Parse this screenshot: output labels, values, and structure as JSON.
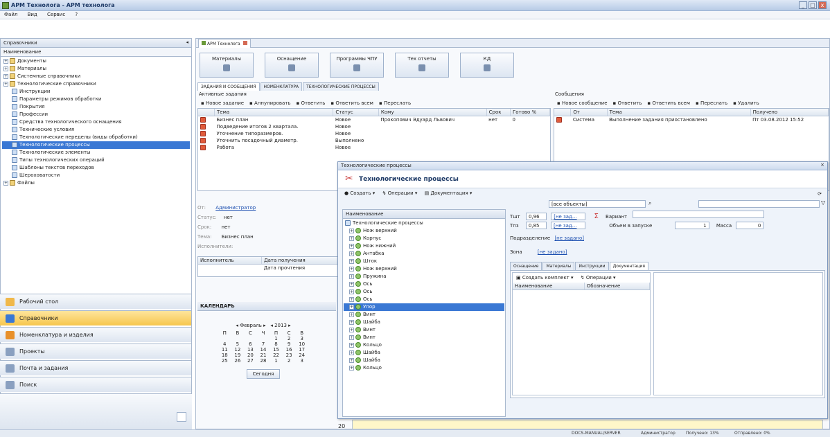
{
  "window": {
    "title": "АРМ Технолога - АРМ технолога",
    "min": "_",
    "max": "□",
    "close": "x"
  },
  "menu": [
    "Файл",
    "Вид",
    "Сервис",
    "?"
  ],
  "left_panel": {
    "title": "Справочники",
    "column_header": "Наименование",
    "tree": [
      {
        "label": "Документы",
        "level": 0,
        "icon": "folder-icon"
      },
      {
        "label": "Материалы",
        "level": 0,
        "icon": "folder-icon"
      },
      {
        "label": "Системные справочники",
        "level": 0,
        "icon": "folder-icon"
      },
      {
        "label": "Технологические справочники",
        "level": 0,
        "icon": "folder-icon"
      },
      {
        "label": "Инструкции",
        "level": 1,
        "icon": "doc-icon"
      },
      {
        "label": "Параметры режимов обработки",
        "level": 1,
        "icon": "doc-icon"
      },
      {
        "label": "Покрытия",
        "level": 1,
        "icon": "doc-icon"
      },
      {
        "label": "Профессии",
        "level": 1,
        "icon": "doc-icon"
      },
      {
        "label": "Средства технологического оснащения",
        "level": 1,
        "icon": "doc-icon"
      },
      {
        "label": "Технические условия",
        "level": 1,
        "icon": "doc-icon"
      },
      {
        "label": "Технологические переделы (виды обработки)",
        "level": 1,
        "icon": "doc-icon"
      },
      {
        "label": "Технологические процессы",
        "level": 1,
        "icon": "doc-icon",
        "selected": true
      },
      {
        "label": "Технологические элементы",
        "level": 1,
        "icon": "doc-icon"
      },
      {
        "label": "Типы технологических операций",
        "level": 1,
        "icon": "doc-icon"
      },
      {
        "label": "Шаблоны текстов переходов",
        "level": 1,
        "icon": "doc-icon"
      },
      {
        "label": "Шероховатости",
        "level": 1,
        "icon": "doc-icon"
      },
      {
        "label": "Файлы",
        "level": 0,
        "icon": "folder-icon"
      }
    ]
  },
  "nav": [
    {
      "label": "Рабочий стол",
      "icon": "desktop-icon",
      "color": "#f0b84a"
    },
    {
      "label": "Справочники",
      "icon": "book-icon",
      "color": "#3a78d4",
      "active": true
    },
    {
      "label": "Номенклатура и изделия",
      "icon": "gear-icon",
      "color": "#e8902a"
    },
    {
      "label": "Проекты",
      "icon": "project-icon",
      "color": "#8aa0c0"
    },
    {
      "label": "Почта и задания",
      "icon": "mail-icon",
      "color": "#8aa0c0"
    },
    {
      "label": "Поиск",
      "icon": "search-icon",
      "color": "#8aa0c0"
    }
  ],
  "main": {
    "tab": "АРМ Технолога",
    "big_buttons": [
      "Материалы",
      "Оснащение",
      "Программы ЧПУ",
      "Тех отчеты",
      "КД"
    ],
    "sub_tabs": [
      "ЗАДАНИЯ И СООБЩЕНИЯ",
      "НОМЕНКЛАТУРА",
      "ТЕХНОЛОГИЧЕСКИЕ ПРОЦЕССЫ"
    ],
    "tasks": {
      "title": "Активные задания",
      "toolbar": [
        "Новое задание",
        "Аннулировать",
        "Ответить",
        "Ответить всем",
        "Переслать"
      ],
      "columns": [
        "",
        "Тема",
        "Статус",
        "Кому",
        "Срок",
        "Готово %"
      ],
      "rows": [
        [
          "",
          "Бизнес план",
          "Новое",
          "Прокопович Эдуард Львович",
          "нет",
          "0"
        ],
        [
          "",
          "Подведение итогов 2 квартала.",
          "Новое",
          "",
          "",
          ""
        ],
        [
          "",
          "Уточнение типоразмеров.",
          "Новое",
          "",
          "",
          ""
        ],
        [
          "",
          "Уточнить посадочный диаметр.",
          "Выполнено",
          "",
          "",
          ""
        ],
        [
          "",
          "Работа",
          "Новое",
          "",
          "",
          ""
        ]
      ]
    },
    "messages": {
      "title": "Сообщения",
      "toolbar": [
        "Новое сообщение",
        "Ответить",
        "Ответить всем",
        "Переслать",
        "Удалить"
      ],
      "columns": [
        "",
        "От",
        "Тема",
        "Получено"
      ],
      "rows": [
        [
          "",
          "Система",
          "Выполнение задания приостановлено",
          "Пт 03.08.2012 15:52"
        ]
      ]
    },
    "details": {
      "from_label": "От:",
      "from_value": "Администратор",
      "status_label": "Статус:",
      "status_value": "нет",
      "term_label": "Срок:",
      "term_value": "нет",
      "topic_label": "Тема:",
      "topic_value": "Бизнес план",
      "executors_label": "Исполнители:",
      "executor_col": "Исполнитель",
      "date1": "Дата получения",
      "date2": "Дата прочтения"
    },
    "calendar": {
      "title": "КАЛЕНДАРЬ",
      "month": "Февраль",
      "year": "2013",
      "weekdays": [
        "П",
        "В",
        "С",
        "Ч",
        "П",
        "С",
        "В"
      ],
      "weeks": [
        [
          "",
          "",
          "",
          "",
          "1",
          "2",
          "3"
        ],
        [
          "4",
          "5",
          "6",
          "7",
          "8",
          "9",
          "10"
        ],
        [
          "11",
          "12",
          "13",
          "14",
          "15",
          "16",
          "17"
        ],
        [
          "18",
          "19",
          "20",
          "21",
          "22",
          "23",
          "24"
        ],
        [
          "25",
          "26",
          "27",
          "28",
          "1",
          "2",
          "3"
        ]
      ],
      "today_btn": "Сегодня",
      "day_label": "20"
    }
  },
  "dialog": {
    "window_title": "Технологические процессы",
    "header": "Технологические процессы",
    "toolbar": [
      "Создать",
      "Операции",
      "Документация"
    ],
    "filter_value": "[все объекты]",
    "tree_header": "Наименование",
    "tree": [
      "Технологические процессы",
      "Нож верхний",
      "Корпус",
      "Нож нижний",
      "Антабка",
      "Шток",
      "Нож верхний",
      "Пружина",
      "Ось",
      "Ось",
      "Ось",
      "Упор",
      "Винт",
      "Шайба",
      "Винт",
      "Винт",
      "Кольцо",
      "Шайба",
      "Шайба",
      "Кольцо"
    ],
    "selected_index": 11,
    "form": {
      "tsht_label": "Тшт",
      "tsht_value": "0,96",
      "tpz_label": "Тпз",
      "tpz_value": "0,85",
      "unset": "[не зад...",
      "variant_label": "Вариант",
      "batch_label": "Объем в запуске",
      "batch_value": "1",
      "mass_label": "Масса",
      "mass_value": "0",
      "division_label": "Подразделение",
      "division_value": "[не задано]",
      "zone_label": "Зона",
      "zone_value": "[не задано]"
    },
    "tabs": [
      "Оснащение",
      "Материалы",
      "Инструкции",
      "Документация"
    ],
    "doc_toolbar": [
      "Создать комплект",
      "Операции"
    ],
    "doc_columns": [
      "Наименование",
      "Обозначение"
    ]
  },
  "status_bar": {
    "server": "DOCS-MANUAL\\SERVER",
    "user": "Администратор",
    "received": "Получено: 13%",
    "sent": "Отправлено: 0%"
  },
  "colors": {
    "selection": "#3a78d4",
    "panel_border": "#a9b9cf",
    "accent": "#f6c64d"
  }
}
